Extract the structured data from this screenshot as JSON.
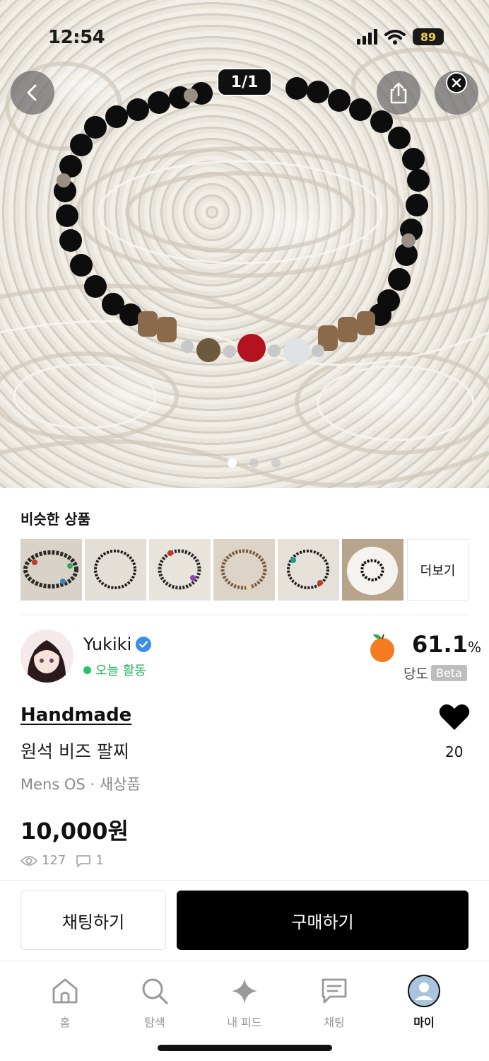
{
  "status_bar": {
    "time": "12:54",
    "battery": "89"
  },
  "gallery": {
    "counter": "1/1",
    "page_count": 3,
    "active_page": 1
  },
  "similar": {
    "title": "비슷한 상품",
    "more_label": "더보기"
  },
  "seller": {
    "name": "Yukiki",
    "activity": "오늘 활동",
    "temperature_value": "61.1",
    "temperature_unit": "%",
    "temperature_label": "당도",
    "beta": "Beta"
  },
  "product": {
    "brand": "Handmade",
    "title": "원석 비즈 팔찌",
    "meta": "Mens OS · 새상품",
    "price": "10,000원",
    "views": "127",
    "comments": "1",
    "likes": "20"
  },
  "actions": {
    "chat_label": "채팅하기",
    "buy_label": "구매하기"
  },
  "tabs": [
    {
      "label": "홈",
      "icon": "home-icon"
    },
    {
      "label": "탐색",
      "icon": "search-icon"
    },
    {
      "label": "내 피드",
      "icon": "sparkle-icon"
    },
    {
      "label": "채팅",
      "icon": "chat-icon"
    },
    {
      "label": "마이",
      "icon": "profile-icon"
    }
  ],
  "colors": {
    "accent": "#000000",
    "online": "#22c55e",
    "verified": "#3d8eea"
  }
}
